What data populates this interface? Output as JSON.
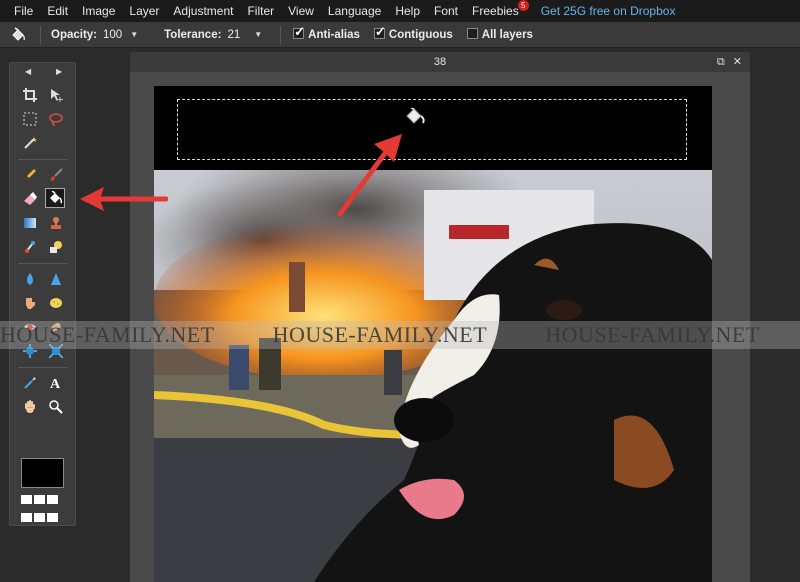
{
  "menu": {
    "items": [
      "File",
      "Edit",
      "Image",
      "Layer",
      "Adjustment",
      "Filter",
      "View",
      "Language",
      "Help",
      "Font",
      "Freebies"
    ],
    "freebies_badge": "5",
    "promo": "Get 25G free on Dropbox"
  },
  "options": {
    "tool_icon": "paint-bucket-icon",
    "opacity_label": "Opacity:",
    "opacity_value": "100",
    "tolerance_label": "Tolerance:",
    "tolerance_value": "21",
    "anti_alias_label": "Anti-alias",
    "anti_alias_checked": true,
    "contiguous_label": "Contiguous",
    "contiguous_checked": true,
    "all_layers_label": "All layers",
    "all_layers_checked": false
  },
  "document": {
    "title": "38"
  },
  "toolbox": {
    "active_tool": "paint-bucket-icon",
    "primary_color": "#000000",
    "tools": [
      "crop-icon",
      "move-icon",
      "marquee-icon",
      "lasso-icon",
      "magic-wand-icon",
      "pencil-icon",
      "brush-icon",
      "eraser-icon",
      "paint-bucket-icon",
      "gradient-icon",
      "clone-stamp-icon",
      "color-replace-icon",
      "drawing-icon",
      "blur-icon",
      "sharpen-icon",
      "smudge-icon",
      "sponge-icon",
      "red-eye-icon",
      "spot-heal-icon",
      "bloat-icon",
      "pinch-icon",
      "color-picker-icon",
      "type-icon",
      "hand-icon",
      "zoom-icon"
    ]
  },
  "watermark": {
    "text": "HOUSE-FAMILY.NET"
  },
  "colors": {
    "menubar": "#1b1b1b",
    "accent_link": "#69b4e6",
    "annotation_arrow": "#e53935",
    "badge": "#d61f1f"
  }
}
